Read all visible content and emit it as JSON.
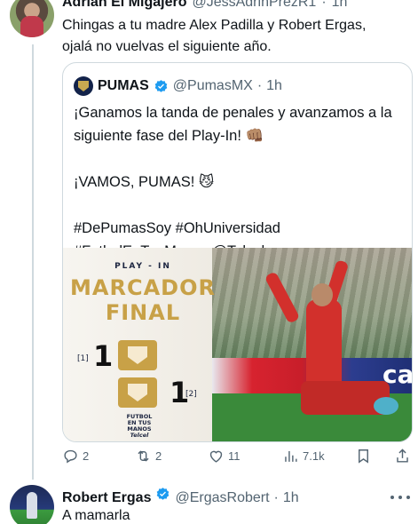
{
  "tweet1": {
    "author_name": "Adrián El Migajero",
    "handle": "@JessAdrinPrezR1",
    "separator": "·",
    "time": "1h",
    "text_line1": "Chingas a tu madre Alex Padilla y Robert Ergas,",
    "text_line2": "ojalá no vuelvas el siguiente año.",
    "actions": {
      "reply_count": "2",
      "retweet_count": "2",
      "like_count": "11",
      "view_count": "7.1k"
    }
  },
  "quote": {
    "author_name": "PUMAS",
    "handle": "@PumasMX",
    "separator": "·",
    "time": "1h",
    "para1": "¡Ganamos la tanda de penales y avanzamos a la siguiente fase del Play-In! 👊🏽",
    "para2": "¡VAMOS, PUMAS! 😼",
    "para3_line1": "#DePumasSoy #OhUniversidad",
    "para3_line2": "#FutbolEnTusManos @Telcel",
    "media": {
      "stage": "PLAY - IN",
      "heading_line1": "MARCADOR",
      "heading_line2": "FINAL",
      "team1_penalties": "[1]",
      "team1_score": "1",
      "team2_score": "1",
      "team2_penalties": "[2]",
      "brand_line1": "FUTBOL",
      "brand_line2": "EN TUS",
      "brand_line3": "MANOS",
      "brand_line4": "Telcel",
      "ad_text": "ca"
    }
  },
  "tweet2": {
    "author_name": "Robert Ergas",
    "handle": "@ErgasRobert",
    "separator": "·",
    "time": "1h",
    "text": "A mamarla"
  },
  "colors": {
    "verified_blue": "#1d9bf0",
    "muted_text": "#536471",
    "border": "#cfd9de",
    "gold": "#c8a147"
  }
}
